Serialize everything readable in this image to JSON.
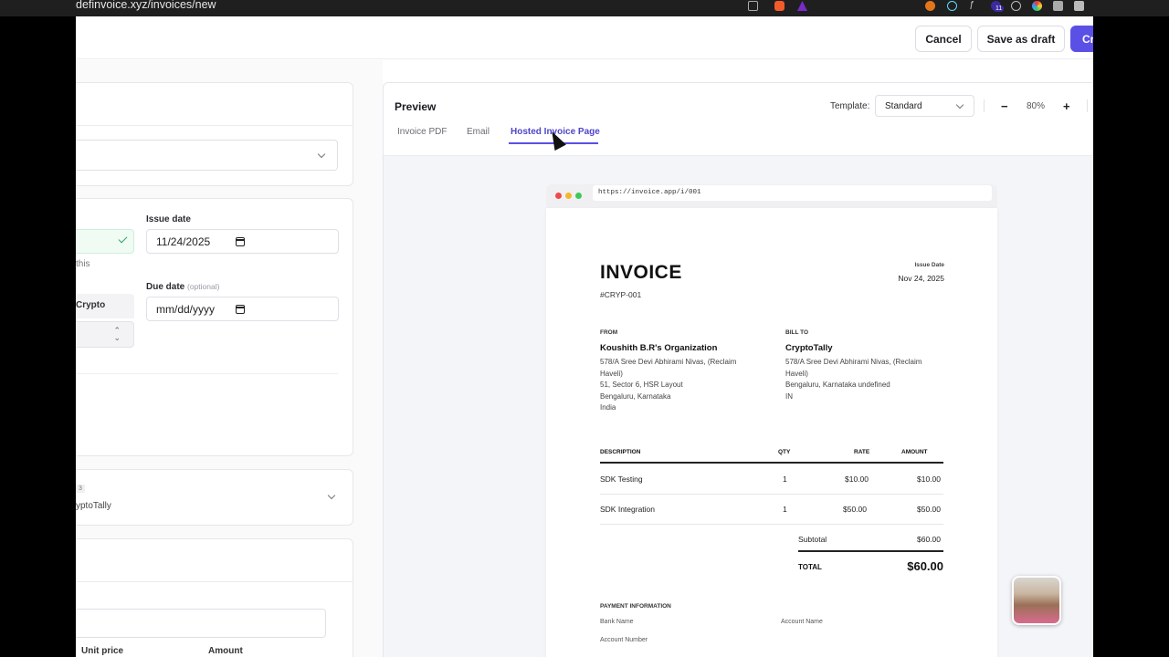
{
  "browser": {
    "url": "definvoice.xyz/invoices/new",
    "badge_count": "11"
  },
  "topbar": {
    "cancel_label": "Cancel",
    "save_draft_label": "Save as draft",
    "create_label_partial": "Cr"
  },
  "form": {
    "issue_date_label": "Issue date",
    "issue_date_value": "11/24/2025",
    "helper_text_fragment": "this",
    "due_date_label": "Due date",
    "due_date_optional": "(optional)",
    "due_date_placeholder": "mm/dd/yyyy",
    "payment_type_fragment": "Crypto",
    "client_badge_fragment": "3",
    "client_name_fragment": "yptoTally",
    "line_items": {
      "unit_price_header": "Unit price",
      "amount_header": "Amount"
    }
  },
  "preview": {
    "title": "Preview",
    "tabs": [
      {
        "label": "Invoice PDF",
        "active": false
      },
      {
        "label": "Email",
        "active": false
      },
      {
        "label": "Hosted Invoice Page",
        "active": true
      }
    ],
    "template_label": "Template:",
    "template_value": "Standard",
    "zoom_minus": "−",
    "zoom_value": "80%",
    "zoom_plus": "+",
    "mock_url": "https://invoice.app/i/001"
  },
  "invoice": {
    "title": "INVOICE",
    "number": "#CRYP-001",
    "issue_date_label": "Issue Date",
    "issue_date": "Nov 24, 2025",
    "from": {
      "label": "FROM",
      "name": "Koushith B.R's Organization",
      "lines": [
        "578/A Sree Devi Abhirami Nivas, (Reclaim",
        "Haveli)",
        "51, Sector 6, HSR Layout",
        "Bengaluru, Karnataka",
        "India"
      ]
    },
    "bill_to": {
      "label": "BILL TO",
      "name": "CryptoTally",
      "lines": [
        "578/A Sree Devi Abhirami Nivas, (Reclaim",
        "Haveli)",
        "Bengaluru, Karnataka undefined",
        "IN"
      ]
    },
    "table": {
      "headers": [
        "DESCRIPTION",
        "QTY",
        "RATE",
        "AMOUNT"
      ],
      "rows": [
        {
          "description": "SDK Testing",
          "qty": "1",
          "rate": "$10.00",
          "amount": "$10.00"
        },
        {
          "description": "SDK Integration",
          "qty": "1",
          "rate": "$50.00",
          "amount": "$50.00"
        }
      ]
    },
    "subtotal_label": "Subtotal",
    "subtotal_value": "$60.00",
    "total_label": "TOTAL",
    "total_value": "$60.00",
    "payment": {
      "label": "PAYMENT INFORMATION",
      "bank_name_label": "Bank Name",
      "account_name_label": "Account Name",
      "account_number_label": "Account Number"
    }
  },
  "colors": {
    "accent": "#5b50e6",
    "accent_text": "#4e46c8",
    "check_green": "#2fa36b"
  }
}
